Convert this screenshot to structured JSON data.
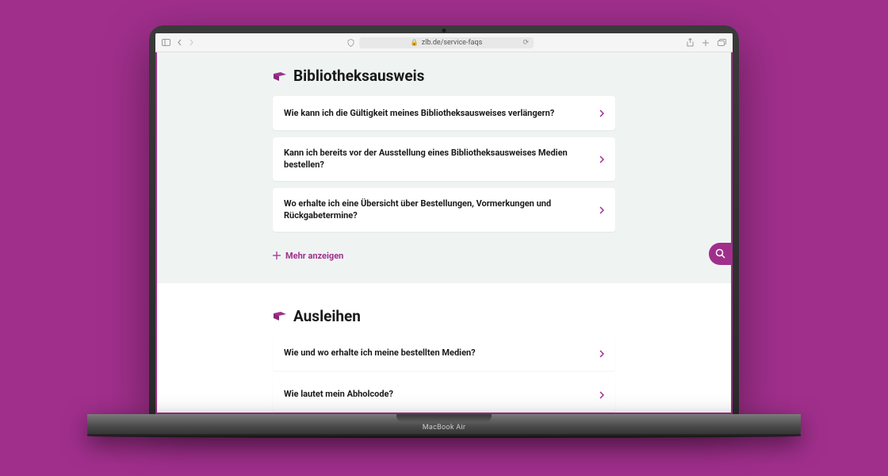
{
  "browser": {
    "url": "zlb.de/service-faqs"
  },
  "device": {
    "label": "MacBook Air"
  },
  "sections": [
    {
      "heading": "Bibliotheksausweis",
      "items": [
        {
          "q": "Wie kann ich die Gültigkeit meines Bibliotheksausweises verlängern?"
        },
        {
          "q": "Kann ich bereits vor der Ausstellung eines Bibliotheksausweises Medien bestellen?"
        },
        {
          "q": "Wo erhalte ich eine Übersicht über Bestellungen, Vormerkungen und Rückgabetermine?"
        }
      ],
      "more_label": "Mehr anzeigen"
    },
    {
      "heading": "Ausleihen",
      "items": [
        {
          "q": "Wie und wo erhalte ich meine bestellten Medien?"
        },
        {
          "q": "Wie lautet mein Abholcode?"
        }
      ]
    }
  ]
}
